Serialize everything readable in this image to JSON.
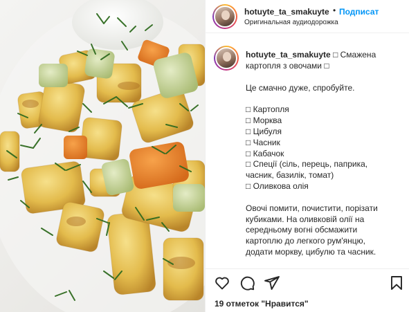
{
  "post": {
    "username": "hotuyte_ta_smakuyte",
    "separator": "•",
    "follow_label": "Подписат",
    "audio_label": "Оригинальная аудиодорожка"
  },
  "caption": {
    "username": "hotuyte_ta_smakuyte",
    "title_line1": "□ Смажена",
    "title_line2": "картопля з овочами □",
    "intro": "Це смачно дуже, спробуйте.",
    "ingredients": [
      "□ Картопля",
      "□ Морква",
      "□ Цибуля",
      "□ Часник",
      "□ Кабачок",
      "□ Спеції (сіль, перець, паприка,",
      "часник, базилік, томат)",
      "□ Оливкова олія"
    ],
    "method": [
      "Овочі помити, почистити, порізати",
      "кубиками. На оливковій олії на",
      "середньому вогні обсмажити",
      "картоплю до легкого рум'янцю,",
      "додати моркву, цибулю та часник."
    ]
  },
  "actions": {
    "likes_text": "19 отметок \"Нравится\"",
    "icons": [
      "heart-icon",
      "comment-icon",
      "share-icon",
      "bookmark-icon"
    ]
  }
}
